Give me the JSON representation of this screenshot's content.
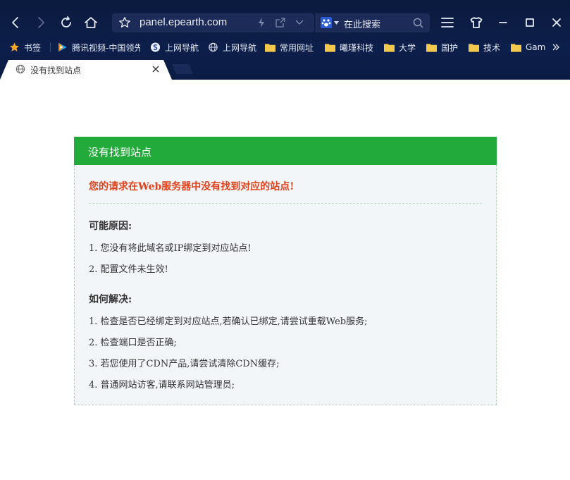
{
  "browser": {
    "url": "panel.epearth.com",
    "search_placeholder": "在此搜索",
    "bookmarks": [
      {
        "label": "书签",
        "icon": "star-icon"
      },
      {
        "label": "腾讯视频-中国领先",
        "icon": "tencent-video-icon"
      },
      {
        "label": "上网导航",
        "icon": "sogou-icon"
      },
      {
        "label": "上网导航",
        "icon": "globe-icon"
      },
      {
        "label": "常用网址",
        "icon": "folder-icon"
      },
      {
        "label": "曦瑾科技",
        "icon": "folder-icon"
      },
      {
        "label": "大学",
        "icon": "folder-icon"
      },
      {
        "label": "国护",
        "icon": "folder-icon"
      },
      {
        "label": "技术",
        "icon": "folder-icon"
      },
      {
        "label": "Gam",
        "icon": "folder-icon"
      }
    ],
    "tab": {
      "title": "没有找到站点"
    },
    "colors": {
      "chrome_bg": "#0b1a3e",
      "folder": "#f2c94c"
    }
  },
  "page": {
    "header": "没有找到站点",
    "error": "您的请求在Web服务器中没有找到对应的站点!",
    "reasons_title": "可能原因:",
    "reasons": [
      "1. 您没有将此域名或IP绑定到对应站点!",
      "2. 配置文件未生效!"
    ],
    "solutions_title": "如何解决:",
    "solutions": [
      "1. 检查是否已经绑定到对应站点,若确认已绑定,请尝试重载Web服务;",
      "2. 检查端口是否正确;",
      "3. 若您使用了CDN产品,请尝试清除CDN缓存;",
      "4. 普通网站访客,请联系网站管理员;"
    ],
    "colors": {
      "header_bg": "#22aa3b",
      "error": "#e0421c",
      "body_bg": "#f3f6f9"
    }
  }
}
